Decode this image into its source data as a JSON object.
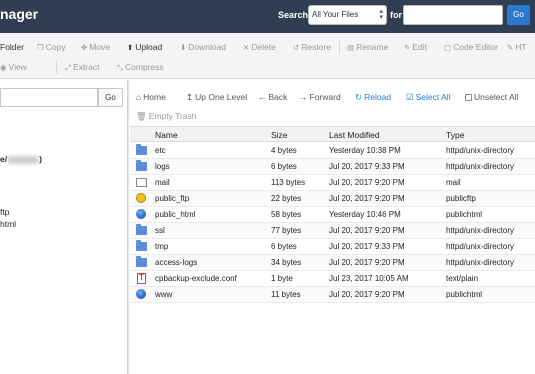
{
  "header": {
    "brand": "nager",
    "search_label": "Search",
    "search_scope": "All Your Files",
    "for_label": "for",
    "search_value": "",
    "go_label": "Go",
    "colors": {
      "bar": "#2f3e52",
      "go": "#2a7bd0"
    }
  },
  "toolbar": {
    "row1": {
      "folder": "Folder",
      "copy": "Copy",
      "move": "Move",
      "upload": "Upload",
      "download": "Download",
      "delete": "Delete",
      "restore": "Restore",
      "rename": "Rename",
      "edit": "Edit",
      "code_editor": "Code Editor",
      "html_editor": "HT"
    },
    "row2": {
      "view": "View",
      "extract": "Extract",
      "compress": "Compress"
    }
  },
  "left": {
    "path_value": "",
    "go_label": "Go",
    "tree": {
      "home_prefix": "e/",
      "home_suffix": ")",
      "item1": "ftp",
      "item2": "html"
    }
  },
  "nav": {
    "home": "Home",
    "up": "Up One Level",
    "back": "Back",
    "forward": "Forward",
    "reload": "Reload",
    "select_all": "Select All",
    "unselect_all": "Unselect All",
    "trash": "Empty Trash"
  },
  "table": {
    "headers": {
      "name": "Name",
      "size": "Size",
      "modified": "Last Modified",
      "type": "Type"
    },
    "rows": [
      {
        "icon": "folder-icon",
        "name": "etc",
        "size": "4 bytes",
        "modified": "Yesterday 10:38 PM",
        "type": "httpd/unix-directory"
      },
      {
        "icon": "folder-icon",
        "name": "logs",
        "size": "6 bytes",
        "modified": "Jul 20, 2017 9:33 PM",
        "type": "httpd/unix-directory"
      },
      {
        "icon": "mail-icon",
        "name": "mail",
        "size": "113 bytes",
        "modified": "Jul 20, 2017 9:20 PM",
        "type": "mail"
      },
      {
        "icon": "ftp-icon",
        "name": "public_ftp",
        "size": "22 bytes",
        "modified": "Jul 20, 2017 9:20 PM",
        "type": "publicftp"
      },
      {
        "icon": "globe-icon",
        "name": "public_html",
        "size": "58 bytes",
        "modified": "Yesterday 10:46 PM",
        "type": "publichtml"
      },
      {
        "icon": "folder-icon",
        "name": "ssl",
        "size": "77 bytes",
        "modified": "Jul 20, 2017 9:20 PM",
        "type": "httpd/unix-directory"
      },
      {
        "icon": "folder-icon",
        "name": "tmp",
        "size": "6 bytes",
        "modified": "Jul 20, 2017 9:33 PM",
        "type": "httpd/unix-directory"
      },
      {
        "icon": "folder-icon",
        "name": "access-logs",
        "size": "34 bytes",
        "modified": "Jul 20, 2017 9:20 PM",
        "type": "httpd/unix-directory"
      },
      {
        "icon": "text-file-icon",
        "name": "cpbackup-exclude.conf",
        "size": "1 byte",
        "modified": "Jul 23, 2017 10:05 AM",
        "type": "text/plain"
      },
      {
        "icon": "globe-icon",
        "name": "www",
        "size": "11 bytes",
        "modified": "Jul 20, 2017 9:20 PM",
        "type": "publichtml"
      }
    ]
  }
}
